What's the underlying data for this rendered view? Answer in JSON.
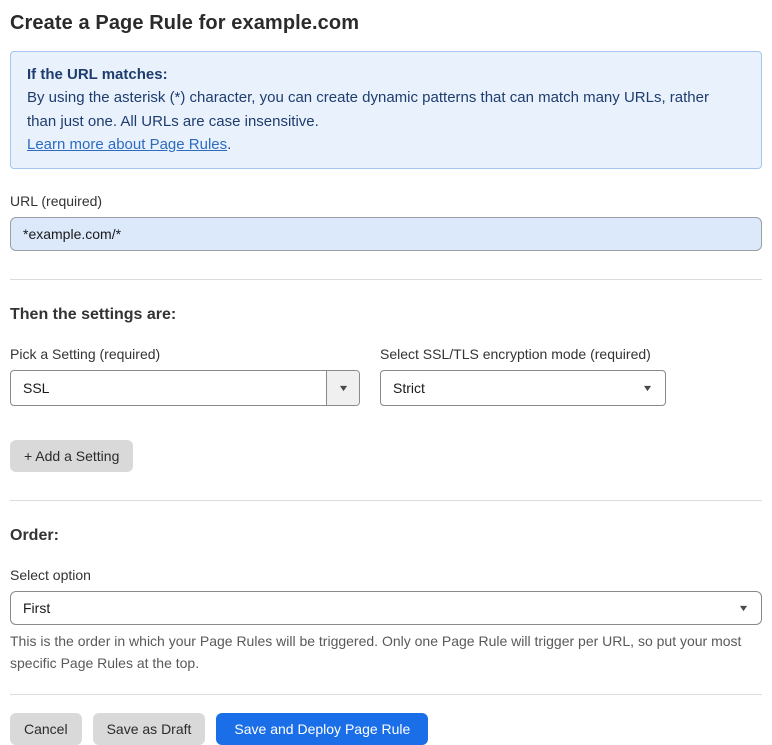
{
  "page": {
    "title": "Create a Page Rule for example.com"
  },
  "info_box": {
    "heading": "If the URL matches:",
    "body": "By using the asterisk (*) character, you can create dynamic patterns that can match many URLs, rather than just one. All URLs are case insensitive.",
    "link_label": "Learn more about Page Rules",
    "link_suffix": "."
  },
  "url_field": {
    "label": "URL (required)",
    "value": "*example.com/*"
  },
  "settings_section": {
    "heading": "Then the settings are:",
    "pick_setting": {
      "label": "Pick a Setting (required)",
      "value": "SSL"
    },
    "ssl_mode": {
      "label": "Select SSL/TLS encryption mode (required)",
      "value": "Strict"
    },
    "add_setting_label": "+ Add a Setting"
  },
  "order_section": {
    "heading": "Order:",
    "select_label": "Select option",
    "value": "First",
    "help_text": "This is the order in which your Page Rules will be triggered. Only one Page Rule will trigger per URL, so put your most specific Page Rules at the top."
  },
  "footer": {
    "cancel_label": "Cancel",
    "save_draft_label": "Save as Draft",
    "save_deploy_label": "Save and Deploy Page Rule"
  },
  "icons": {
    "dropdown_arrow": "▼"
  },
  "colors": {
    "primary_button": "#1a6ee8",
    "info_bg": "#e9f2fc",
    "info_border": "#a3c7ee",
    "info_text": "#1e3c6e",
    "link": "#2d6bbf",
    "input_bg": "#dbe9fb"
  }
}
